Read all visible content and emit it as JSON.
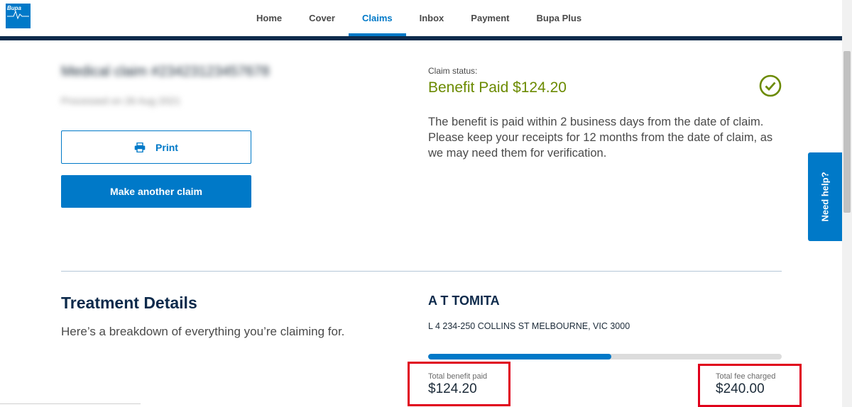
{
  "brand": {
    "logo_text": "Bupa",
    "accent_color": "#0079c8",
    "header_bar_color": "#0d2a4b"
  },
  "nav": {
    "items": [
      {
        "label": "Home"
      },
      {
        "label": "Cover"
      },
      {
        "label": "Claims",
        "active": true
      },
      {
        "label": "Inbox"
      },
      {
        "label": "Payment"
      },
      {
        "label": "Bupa Plus"
      }
    ]
  },
  "claim": {
    "title": "Medical claim #23423123457678",
    "processed": "Processed on 26 Aug 2021",
    "print_label": "Print",
    "make_another_label": "Make another claim"
  },
  "status": {
    "label": "Claim status:",
    "value": "Benefit Paid $124.20",
    "color": "#6b8a00",
    "icon": "check-circle-icon",
    "description": "The benefit is paid within 2 business days from the date of claim. Please keep your receipts for 12 months from the date of claim, as we may need them for verification."
  },
  "help": {
    "label": "Need help?"
  },
  "treatment": {
    "title": "Treatment Details",
    "description": "Here’s a breakdown of everything you’re claiming for."
  },
  "provider": {
    "name": "A T TOMITA",
    "address": "L 4 234-250 COLLINS ST MELBOURNE, VIC 3000",
    "benefit_ratio": 0.5175
  },
  "totals": {
    "benefit_label": "Total benefit paid",
    "benefit_value": "$124.20",
    "fee_label": "Total fee charged",
    "fee_value": "$240.00"
  }
}
